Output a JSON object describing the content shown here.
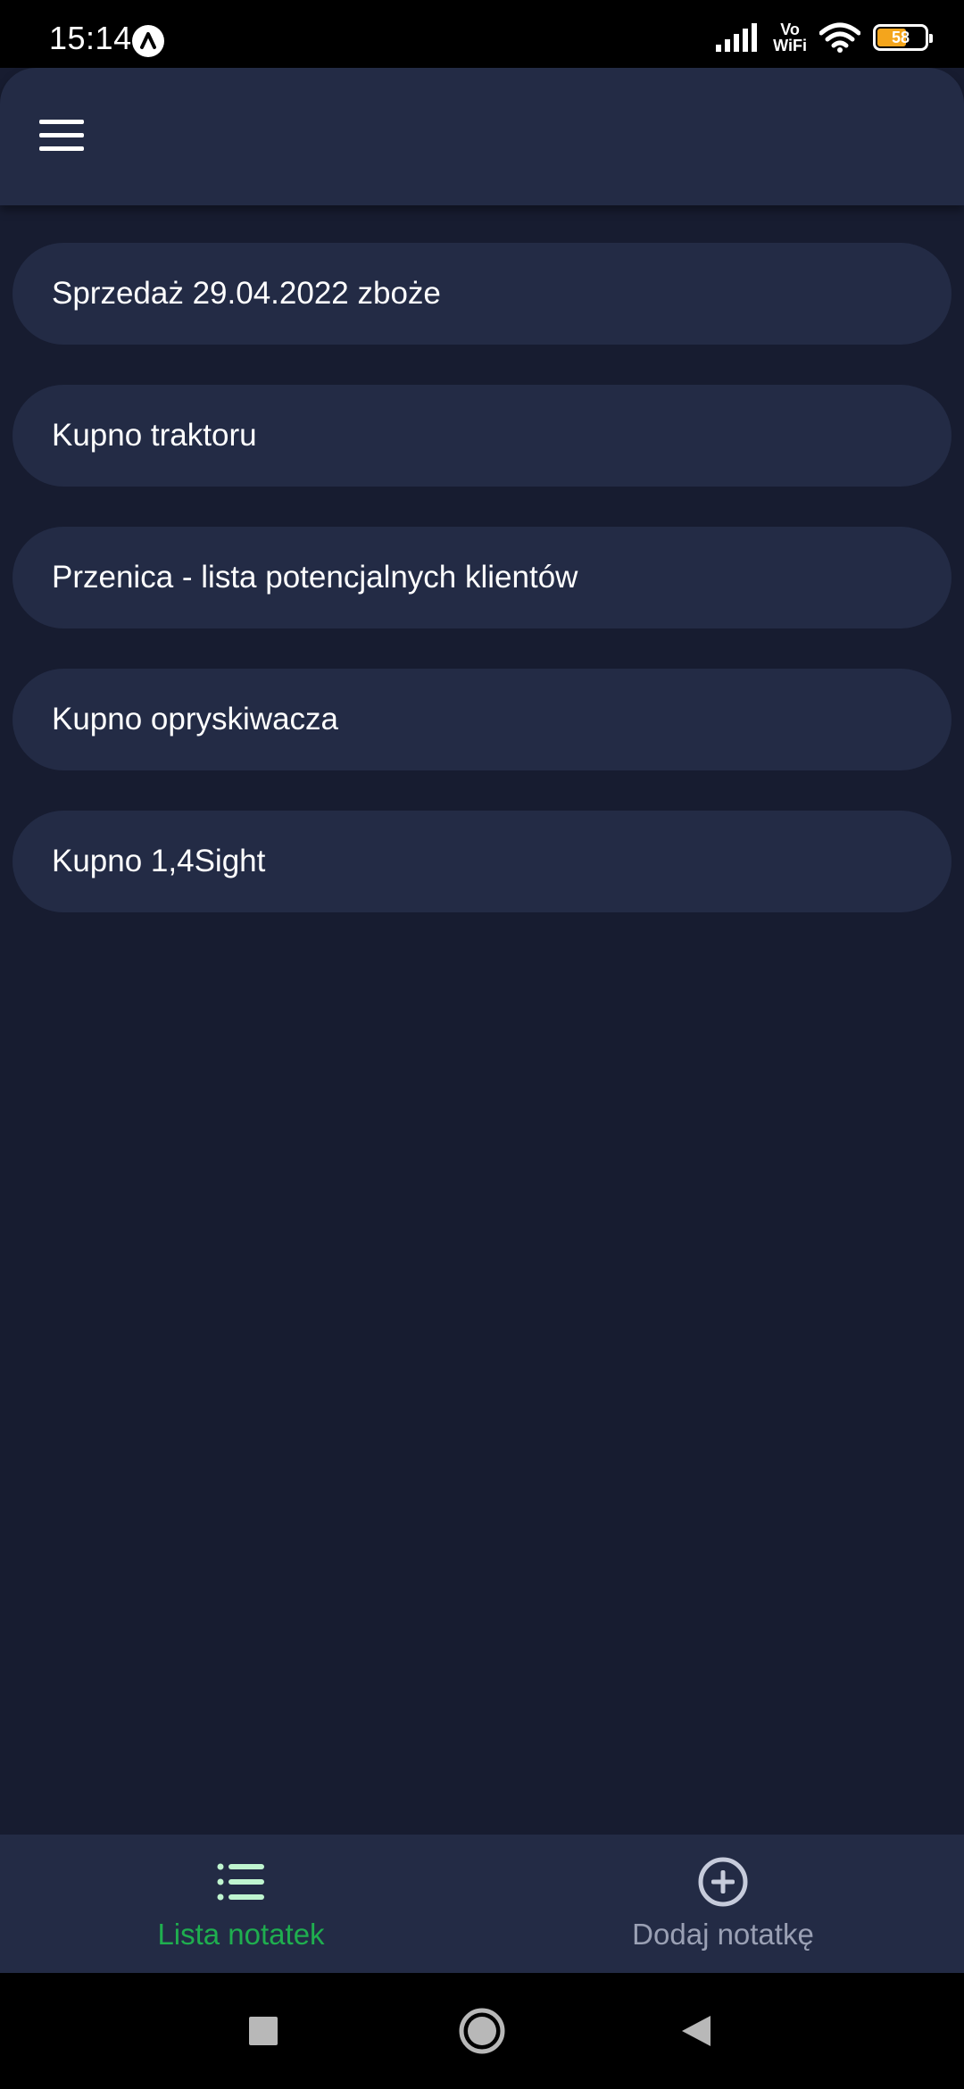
{
  "status_bar": {
    "time": "15:14",
    "network_label_top": "Vo",
    "network_label_bottom": "WiFi",
    "battery_level": "58",
    "battery_color": "#f4a51c"
  },
  "header": {
    "menu_icon": "hamburger-menu-icon"
  },
  "notes": [
    {
      "title": "Sprzedaż 29.04.2022 zboże"
    },
    {
      "title": "Kupno traktoru"
    },
    {
      "title": "Przenica - lista potencjalnych klientów"
    },
    {
      "title": "Kupno opryskiwacza"
    },
    {
      "title": "Kupno 1,4Sight"
    }
  ],
  "bottom_nav": {
    "items": [
      {
        "label": "Lista notatek",
        "icon": "list-icon",
        "active": true,
        "color": "#1fae4f"
      },
      {
        "label": "Dodaj notatkę",
        "icon": "add-circle-icon",
        "active": false,
        "color": "#9aa0b4"
      }
    ]
  },
  "system_nav": {
    "buttons": [
      "recents-icon",
      "home-icon",
      "back-icon"
    ]
  },
  "colors": {
    "background": "#171c30",
    "surface": "#232b45",
    "accent": "#1fae4f",
    "text": "#ffffff",
    "inactive": "#9aa0b4"
  }
}
